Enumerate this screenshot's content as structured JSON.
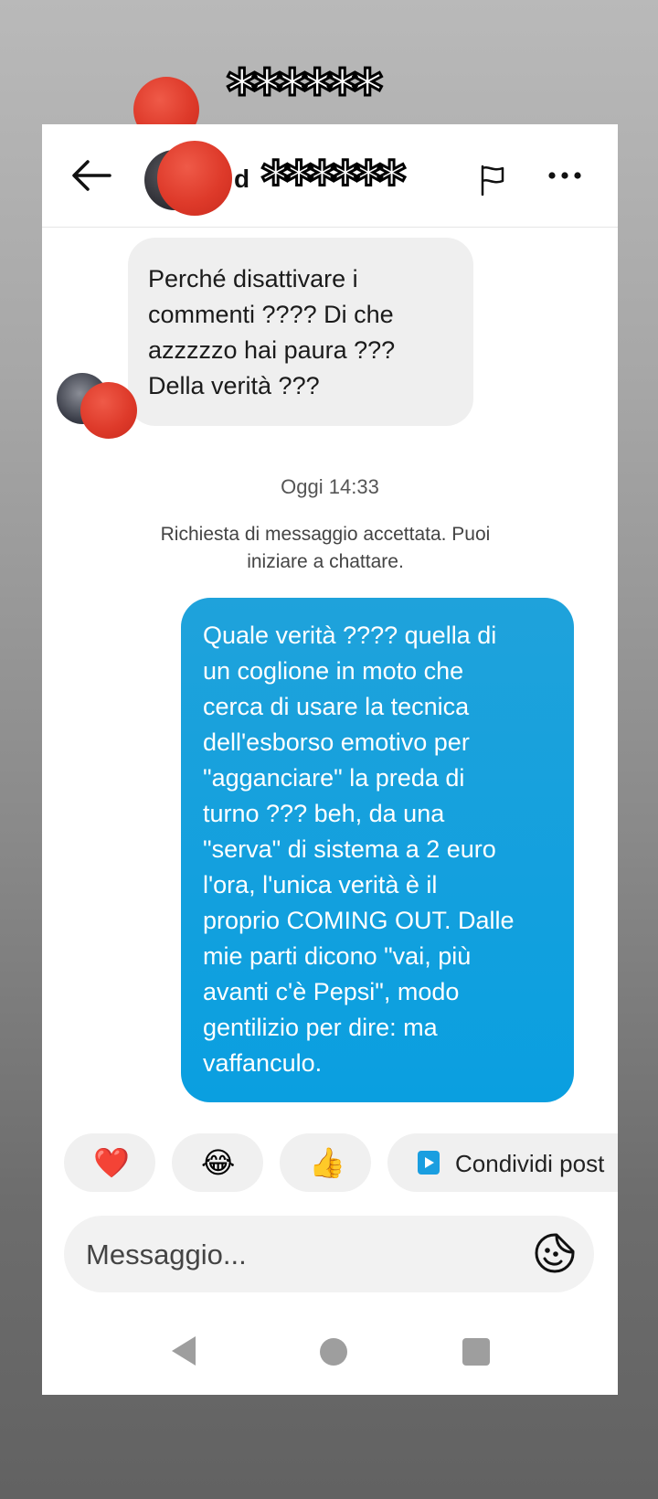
{
  "overlay": {
    "masked_name": "******"
  },
  "header": {
    "name_lead": "d",
    "masked_name": "******",
    "icons": {
      "back": "arrow-left-icon",
      "flag": "flag-icon",
      "more": "more-options-icon"
    }
  },
  "conversation": {
    "received_message": "Perché disattivare i\ncommenti ???? Di che\nazzzzzo hai paura ???\nDella verità ???",
    "timestamp": "Oggi 14:33",
    "system_notice": "Richiesta di messaggio accettata. Puoi\niniziare a chattare.",
    "sent_message": "Quale verità ???? quella di\nun coglione in moto che\ncerca di usare la tecnica\ndell'esborso emotivo per\n\"agganciare\" la preda di\nturno ??? beh, da una\n\"serva\" di sistema a 2 euro\nl'ora, l'unica verità è il\nproprio COMING OUT. Dalle\nmie parti dicono \"vai, più\navanti c'è Pepsi\", modo\ngentilizio per dire: ma\nvaffanculo."
  },
  "quick_reactions": {
    "heart": "❤️",
    "laugh": "😂",
    "thumbs_up": "👍",
    "share_label": "Condividi post",
    "share_icon": "play-square-icon"
  },
  "composer": {
    "placeholder": "Messaggio...",
    "sticker_icon": "sticker-face-icon"
  },
  "system_nav": {
    "back": "nav-back-icon",
    "home": "nav-home-icon",
    "recents": "nav-recents-icon"
  },
  "colors": {
    "sent_bubble": "#0a9fe0",
    "received_bubble": "#efefef",
    "heart": "#e5213a"
  }
}
